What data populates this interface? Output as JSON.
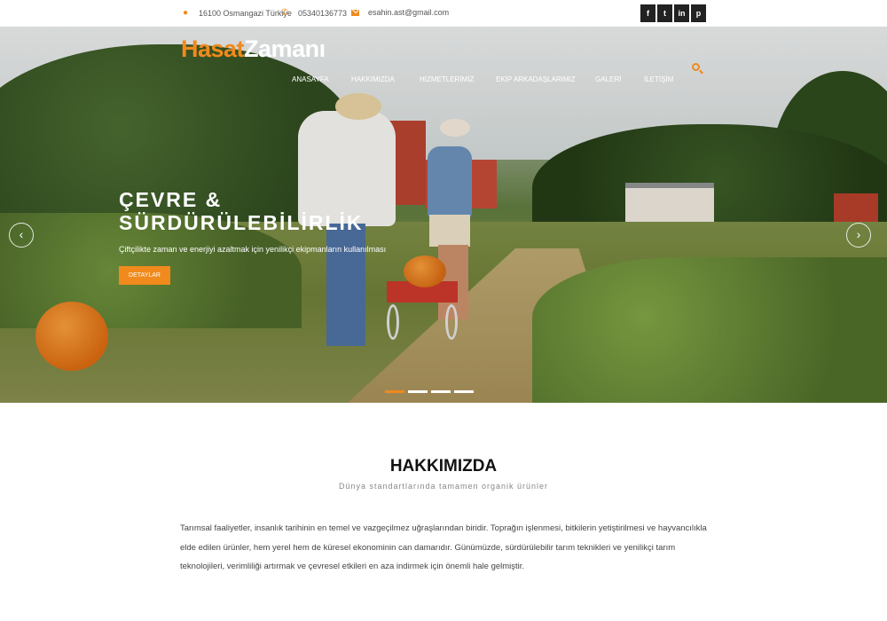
{
  "topbar": {
    "address": "16100 Osmangazi Türkiye",
    "phone": "05340136773",
    "email": "esahin.ast@gmail.com",
    "social": [
      {
        "icon": "facebook-icon",
        "label": "f"
      },
      {
        "icon": "twitter-icon",
        "label": "t"
      },
      {
        "icon": "linkedin-icon",
        "label": "in"
      },
      {
        "icon": "pinterest-icon",
        "label": "p"
      }
    ]
  },
  "header": {
    "logo_part1": "Hasat",
    "logo_part2": "Zamanı",
    "nav": [
      "ANASAYFA",
      "HAKKIMIZDA",
      "HİZMETLERİMİZ",
      "EKİP ARKADAŞLARIMIZ",
      "GALERİ",
      "İLETİŞİM"
    ]
  },
  "slider": {
    "title": "ÇEVRE & SÜRDÜRÜLEBİLİRLİK",
    "subtitle": "Çiftçilikte zaman ve enerjiyi azaltmak için yenilikçi ekipmanların kullanılması",
    "button_label": "DETAYLAR",
    "prev_label": "‹",
    "next_label": "›",
    "total_slides": 4,
    "active_slide": 1
  },
  "about": {
    "title": "HAKKIMIZDA",
    "subtitle": "Dünya standartlarında tamamen organik ürünler",
    "text": "Tarımsal faaliyetler, insanlık tarihinin en temel ve vazgeçilmez uğraşlarından biridir. Toprağın işlenmesi, bitkilerin yetiştirilmesi ve hayvancılıkla elde edilen ürünler, hem yerel hem de küresel ekonominin can damarıdır. Günümüzde, sürdürülebilir tarım teknikleri ve yenilikçi tarım teknolojileri, verimliliği artırmak ve çevresel etkileri en aza indirmek için önemli hale gelmiştir."
  },
  "colors": {
    "accent": "#f08a1c",
    "dark": "#222222"
  }
}
